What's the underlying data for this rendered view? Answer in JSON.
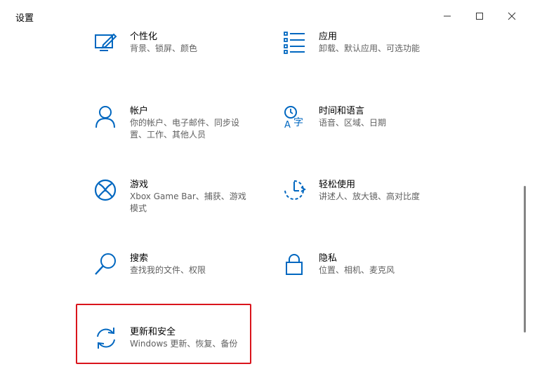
{
  "window": {
    "title": "设置"
  },
  "colors": {
    "accent": "#0067c0",
    "highlight": "#d9141c"
  },
  "tiles": [
    {
      "name": "个性化",
      "desc": "背景、锁屏、颜色",
      "icon": "personalization-icon"
    },
    {
      "name": "应用",
      "desc": "卸载、默认应用、可选功能",
      "icon": "apps-icon"
    },
    {
      "name": "帐户",
      "desc": "你的帐户、电子邮件、同步设置、工作、其他人员",
      "icon": "account-icon"
    },
    {
      "name": "时间和语言",
      "desc": "语音、区域、日期",
      "icon": "time-language-icon"
    },
    {
      "name": "游戏",
      "desc": "Xbox Game Bar、捕获、游戏模式",
      "icon": "xbox-icon"
    },
    {
      "name": "轻松使用",
      "desc": "讲述人、放大镜、高对比度",
      "icon": "ease-of-access-icon"
    },
    {
      "name": "搜索",
      "desc": "查找我的文件、权限",
      "icon": "search-icon"
    },
    {
      "name": "隐私",
      "desc": "位置、相机、麦克风",
      "icon": "lock-icon"
    },
    {
      "name": "更新和安全",
      "desc": "Windows 更新、恢复、备份",
      "icon": "sync-icon"
    }
  ]
}
